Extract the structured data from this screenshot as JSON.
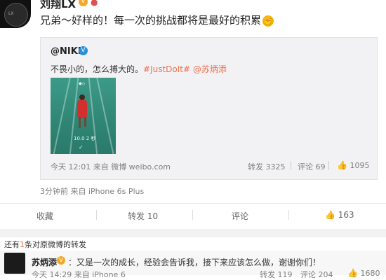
{
  "post": {
    "author": "刘翔LX",
    "text": "兄弟～好样的！每一次的挑战都将是最好的积累",
    "meta": "3分钟前 来自 iPhone 6s Plus"
  },
  "repost": {
    "author": "@NIKE",
    "text_plain": "不畏小的，怎么搏大的。",
    "tags": "#JustDoIt# @苏炳添",
    "photo_time": "10.0 2 秒",
    "meta": "今天 12:01 来自 微博 weibo.com",
    "forward": "转发 3325",
    "comment": "评论 69",
    "like": "1095"
  },
  "actions": {
    "favorite": "收藏",
    "forward": "转发 10",
    "comment": "评论",
    "like": "163"
  },
  "more_repost": {
    "prefix": "还有",
    "count": "1",
    "suffix": "条对原微博的转发"
  },
  "reply": {
    "author": "苏炳添",
    "text": "：又是一次的成长，经验会告诉我，接下来应该怎么做，谢谢你们！",
    "meta": "今天 14:29 来自 iPhone 6",
    "forward": "转发 119",
    "comment": "评论 204",
    "like": "1680"
  },
  "colors": {
    "accent": "#eb7350",
    "muted": "#808080",
    "verified_orange": "#f5a623",
    "verified_blue": "#2b8fd8"
  }
}
